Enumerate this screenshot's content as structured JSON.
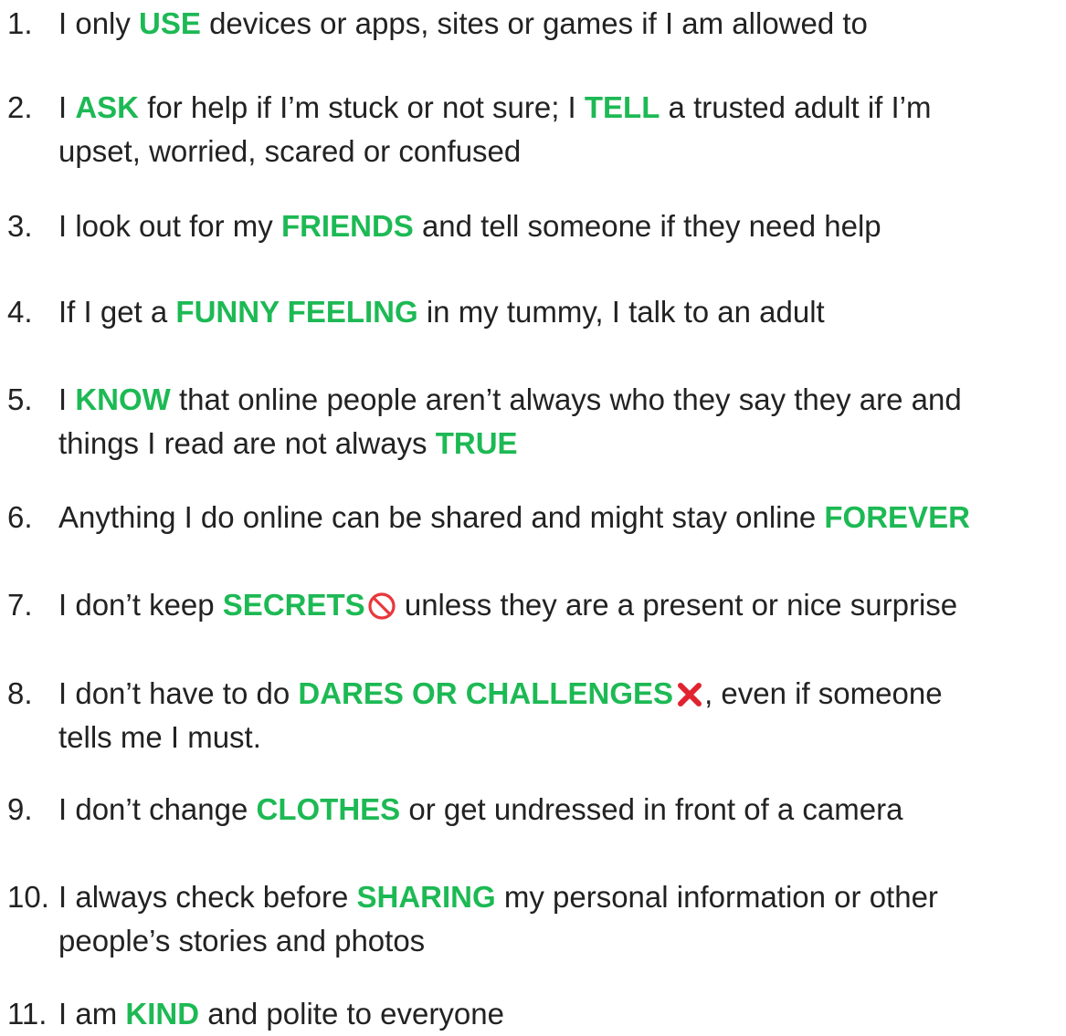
{
  "colors": {
    "text": "#222222",
    "keyword": "#1db954",
    "prohibited_icon": "#e8383d",
    "cross_icon": "#e0242f"
  },
  "rules": [
    {
      "num": "1.",
      "l1": {
        "pre": "I only ",
        "kw": "USE",
        "post": " devices or apps, sites or games if I am allowed to"
      }
    },
    {
      "num": "2.",
      "l1": {
        "pre": "I ",
        "kw": "ASK",
        "mid": " for help if I’m stuck or not sure; I ",
        "kw2": "TELL",
        "post": " a trusted adult if I’m"
      },
      "l2": {
        "text": "upset, worried, scared or confused"
      }
    },
    {
      "num": "3.",
      "l1": {
        "pre": "I look out for my ",
        "kw": "FRIENDS",
        "post": " and tell someone if they need help"
      }
    },
    {
      "num": "4.",
      "l1": {
        "pre": "If I get a ",
        "kw": "FUNNY FEELING",
        "post": " in my tummy, I talk to an adult"
      }
    },
    {
      "num": "5.",
      "l1": {
        "pre": "I ",
        "kw": "KNOW",
        "post": " that online people aren’t always who they say they are and"
      },
      "l2": {
        "pre": "things I read are not always ",
        "kw": "TRUE"
      }
    },
    {
      "num": "6.",
      "l1": {
        "pre": "Anything I do online can be shared and might stay online ",
        "kw": "FOREVER"
      }
    },
    {
      "num": "7.",
      "l1": {
        "pre": "I don’t keep ",
        "kw": "SECRETS",
        "icon": "prohibited-icon",
        "post": " unless they are a present or nice surprise"
      }
    },
    {
      "num": "8.",
      "l1": {
        "pre": "I don’t have to do ",
        "kw": "DARES OR CHALLENGES",
        "icon": "cross-mark-icon",
        "post": ", even if someone"
      },
      "l2": {
        "text": "tells me I must."
      }
    },
    {
      "num": "9.",
      "l1": {
        "pre": "I don’t change ",
        "kw": "CLOTHES",
        "post": " or get undressed in front of a camera"
      }
    },
    {
      "num": "10.",
      "l1": {
        "pre": "I always check before ",
        "kw": "SHARING",
        "post": " my personal information or other"
      },
      "l2": {
        "text": "people’s stories and photos"
      }
    },
    {
      "num": "11.",
      "l1": {
        "pre": "I am ",
        "kw": "KIND",
        "post": " and polite to everyone"
      }
    }
  ]
}
